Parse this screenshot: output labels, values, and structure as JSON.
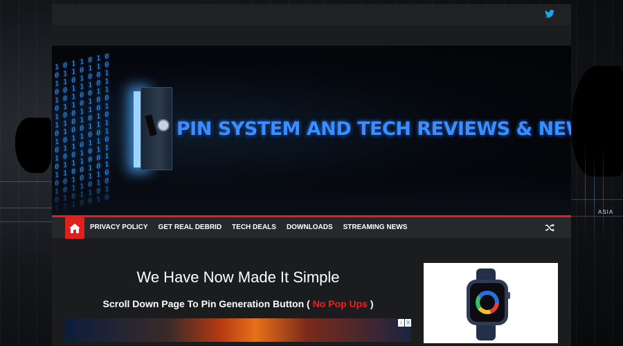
{
  "site": {
    "banner_title": "PIN SYSTEM AND TECH REVIEWS & NEWS"
  },
  "topbar": {
    "social_icon": "twitter-icon"
  },
  "nav": {
    "home_icon": "home-icon",
    "items": [
      {
        "label": "PRIVACY POLICY"
      },
      {
        "label": "GET REAL DEBRID"
      },
      {
        "label": "TECH DEALS"
      },
      {
        "label": "DOWNLOADS"
      },
      {
        "label": "STREAMING NEWS"
      }
    ],
    "random_icon": "shuffle-icon"
  },
  "content": {
    "headline": "We Have Now Made It Simple",
    "subline_prefix": "Scroll Down Page To Pin Generation Button (",
    "subline_highlight": "No Pop Ups",
    "subline_suffix": ")"
  },
  "ad_choices": {
    "info_label": "i",
    "close_label": "X"
  },
  "sidebar_ad": {
    "image_icon": "smartwatch-icon"
  },
  "backdrop": {
    "map_label": "ASIA"
  },
  "colors": {
    "accent_red": "#e0201f",
    "nav_bg": "#27282a",
    "page_bg": "#1b1c1e",
    "title_blue": "#3a8fff",
    "highlight_red": "#ff1a1a"
  }
}
